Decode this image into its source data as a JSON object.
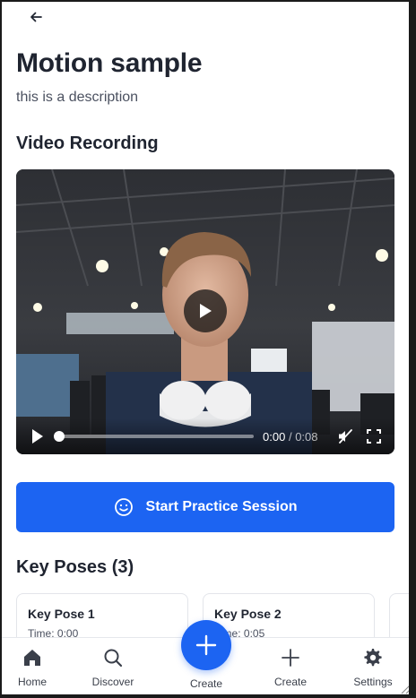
{
  "page": {
    "title": "Motion sample",
    "description": "this is a description"
  },
  "icons": {
    "back": "arrow-left-icon",
    "practice": "smiley-icon",
    "home": "home-icon",
    "discover": "search-icon",
    "create_fab": "plus-icon",
    "create": "plus-icon",
    "settings": "gear-icon"
  },
  "video": {
    "section_title": "Video Recording",
    "current_time": "0:00",
    "separator": "/",
    "duration": "0:08",
    "progress": 0.0
  },
  "practice": {
    "label": "Start Practice Session"
  },
  "key_poses": {
    "section_title": "Key Poses (3)",
    "items": [
      {
        "name": "Key Pose 1",
        "time": "Time: 0:00"
      },
      {
        "name": "Key Pose 2",
        "time": "Time: 0:05"
      },
      {
        "name": "",
        "time": ""
      }
    ]
  },
  "nav": {
    "home": "Home",
    "discover": "Discover",
    "create_fab": "Create",
    "create": "Create",
    "settings": "Settings"
  },
  "colors": {
    "primary": "#1c64f2",
    "text": "#1f2430",
    "muted": "#4b5160"
  }
}
